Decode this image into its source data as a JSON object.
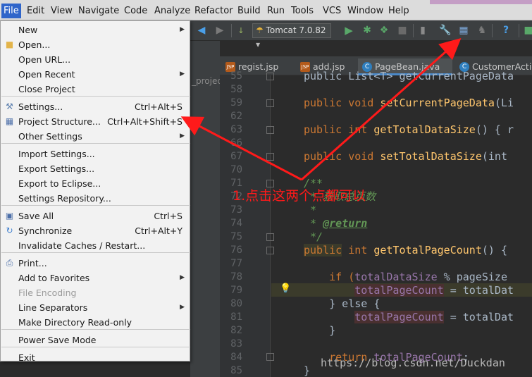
{
  "menubar": {
    "items": [
      "File",
      "Edit",
      "View",
      "Navigate",
      "Code",
      "Analyze",
      "Refactor",
      "Build",
      "Run",
      "Tools",
      "VCS",
      "Window",
      "Help"
    ]
  },
  "toolbar": {
    "run_config": "Tomcat 7.0.82"
  },
  "project_panel_label": "_projec",
  "tabs": [
    {
      "label": "regist.jsp",
      "icon": "jsp-file-icon",
      "icon_text": "JSP"
    },
    {
      "label": "add.jsp",
      "icon": "jsp-file-icon",
      "icon_text": "JSP"
    },
    {
      "label": "PageBean.java",
      "icon": "class-icon",
      "icon_text": "C"
    },
    {
      "label": "CustomerActio",
      "icon": "class-icon",
      "icon_text": "C"
    }
  ],
  "line_numbers": [
    "55",
    "58",
    "59",
    "62",
    "63",
    "66",
    "67",
    "70",
    "71",
    "72",
    "73",
    "74",
    "75",
    "76",
    "77",
    "78",
    "79",
    "80",
    "81",
    "82",
    "83",
    "84",
    "85"
  ],
  "file_menu": {
    "items": [
      {
        "label": "New",
        "shortcut": "",
        "submenu": true,
        "icon": ""
      },
      {
        "label": "Open...",
        "shortcut": "",
        "submenu": false,
        "icon": "folder-icon"
      },
      {
        "label": "Open URL...",
        "shortcut": "",
        "submenu": false,
        "icon": ""
      },
      {
        "label": "Open Recent",
        "shortcut": "",
        "submenu": true,
        "icon": ""
      },
      {
        "label": "Close Project",
        "shortcut": "",
        "submenu": false,
        "icon": ""
      },
      {
        "label": "Settings...",
        "shortcut": "Ctrl+Alt+S",
        "submenu": false,
        "icon": "settings-wrench-icon"
      },
      {
        "label": "Project Structure...",
        "shortcut": "Ctrl+Alt+Shift+S",
        "submenu": false,
        "icon": "project-structure-icon"
      },
      {
        "label": "Other Settings",
        "shortcut": "",
        "submenu": true,
        "icon": ""
      },
      {
        "label": "Import Settings...",
        "shortcut": "",
        "submenu": false,
        "icon": ""
      },
      {
        "label": "Export Settings...",
        "shortcut": "",
        "submenu": false,
        "icon": ""
      },
      {
        "label": "Export to Eclipse...",
        "shortcut": "",
        "submenu": false,
        "icon": ""
      },
      {
        "label": "Settings Repository...",
        "shortcut": "",
        "submenu": false,
        "icon": ""
      },
      {
        "label": "Save All",
        "shortcut": "Ctrl+S",
        "submenu": false,
        "icon": "save-all-icon"
      },
      {
        "label": "Synchronize",
        "shortcut": "Ctrl+Alt+Y",
        "submenu": false,
        "icon": "sync-icon"
      },
      {
        "label": "Invalidate Caches / Restart...",
        "shortcut": "",
        "submenu": false,
        "icon": ""
      },
      {
        "label": "Print...",
        "shortcut": "",
        "submenu": false,
        "icon": "print-icon"
      },
      {
        "label": "Add to Favorites",
        "shortcut": "",
        "submenu": true,
        "icon": ""
      },
      {
        "label": "File Encoding",
        "shortcut": "",
        "submenu": false,
        "icon": "",
        "disabled": true
      },
      {
        "label": "Line Separators",
        "shortcut": "",
        "submenu": true,
        "icon": ""
      },
      {
        "label": "Make Directory Read-only",
        "shortcut": "",
        "submenu": false,
        "icon": ""
      },
      {
        "label": "Power Save Mode",
        "shortcut": "",
        "submenu": false,
        "icon": ""
      },
      {
        "label": "Exit",
        "shortcut": "",
        "submenu": false,
        "icon": ""
      }
    ]
  },
  "code": {
    "l55": "public List<T> getCurrentPageData",
    "l58": "",
    "l59a": "public void ",
    "l59b": "setCurrentPageData",
    "l59c": "(Li",
    "l62": "",
    "l63a": "public int ",
    "l63b": "getTotalDataSize",
    "l63c": "() { r",
    "l66": "",
    "l67a": "public void ",
    "l67b": "setTotalDataSize",
    "l67c": "(int",
    "l70": "",
    "l71": "/**",
    "l72": " * 获取总页数",
    "l73": " *",
    "l74a": " * ",
    "l74b": "@return",
    "l75": " */",
    "l76a": "public",
    "l76b": " int ",
    "l76c": "getTotalPageCount",
    "l76d": "() {",
    "l78a": "    if (",
    "l78b": "totalDataSize",
    "l78c": " % pageSize",
    "l79a": "        ",
    "l79b": "totalPageCount",
    "l79c": " = totalDat",
    "l80": "    } else {",
    "l81a": "        ",
    "l81b": "totalPageCount",
    "l81c": " = totalDat",
    "l82": "    }",
    "l84a": "    return ",
    "l84b": "totalPageCount",
    "l84c": ";",
    "l85": "}"
  },
  "annotation": "1.点击这两个点都可以",
  "watermark": "https://blog.csdn.net/Duckdan",
  "colors": {
    "annotation": "#ff1a1a",
    "menu_highlight": "#2f65ca"
  }
}
